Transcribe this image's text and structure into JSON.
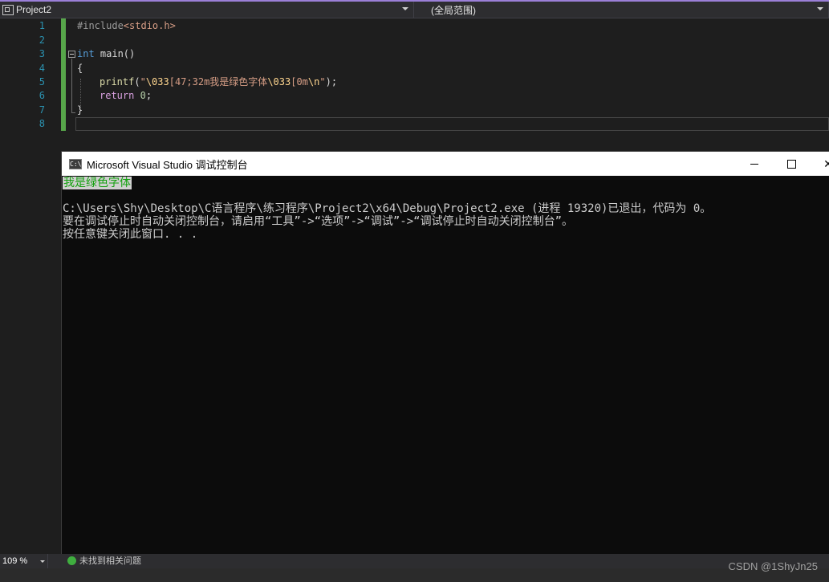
{
  "navbar": {
    "project": "Project2",
    "scope": "(全局范围)"
  },
  "editor": {
    "line_numbers": [
      "1",
      "2",
      "3",
      "4",
      "5",
      "6",
      "7",
      "8"
    ],
    "code": {
      "include_directive": "#include",
      "include_file": "<stdio.h>",
      "line3_type": "int",
      "line3_rest": " main()",
      "brace_open": "{",
      "printf_fn": "printf",
      "printf_open": "(",
      "str_q1": "\"",
      "str_esc1": "\\033",
      "str_mid": "[47;32m我是绿色字体",
      "str_esc2": "\\033",
      "str_mid2": "[0m",
      "str_esc3": "\\n",
      "str_q2": "\"",
      "printf_close": ");",
      "return_kw": "return",
      "return_val": "0",
      "semicolon": ";",
      "brace_close": "}"
    }
  },
  "console": {
    "title": "Microsoft Visual Studio 调试控制台",
    "icon_label": "C:\\",
    "close_glyph": "✕",
    "output": {
      "green_text": "我是绿色字体",
      "exit_line": "C:\\Users\\Shy\\Desktop\\C语言程序\\练习程序\\Project2\\x64\\Debug\\Project2.exe (进程 19320)已退出，代码为 0。",
      "hint_line": "要在调试停止时自动关闭控制台，请启用“工具”->“选项”->“调试”->“调试停止时自动关闭控制台”。",
      "press_line": "按任意键关闭此窗口. . ."
    }
  },
  "statusbar": {
    "zoom": "109 %",
    "issues": "未找到相关问题"
  },
  "watermark": "CSDN @1ShyJn25",
  "colors": {
    "accent": "#9b7fd8",
    "change_bar": "#57a64a",
    "console_green": "#13a10e"
  }
}
